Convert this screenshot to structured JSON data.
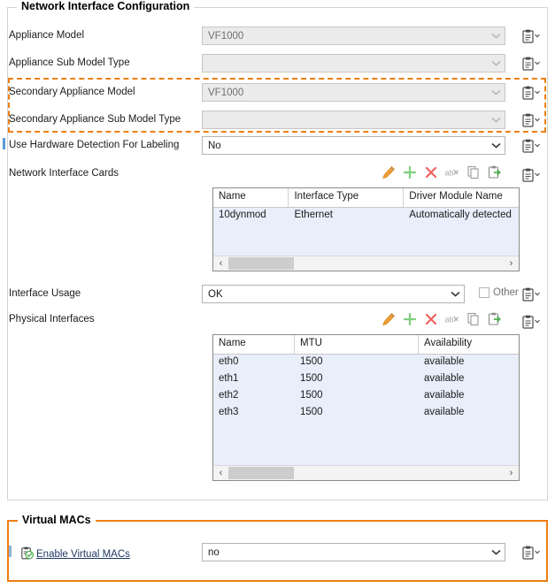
{
  "panels": {
    "network": {
      "title": "Network Interface Configuration",
      "highlight_color": "#ee7f11"
    },
    "virtual_macs": {
      "title": "Virtual MACs",
      "border_color": "#ee7f11"
    }
  },
  "fields": {
    "appliance_model": {
      "label": "Appliance Model",
      "value": "VF1000",
      "enabled": false
    },
    "appliance_sub_model_type": {
      "label": "Appliance Sub Model Type",
      "value": "",
      "enabled": false
    },
    "secondary_appliance_model": {
      "label": "Secondary Appliance Model",
      "value": "VF1000",
      "enabled": false
    },
    "secondary_appliance_sub_model_type": {
      "label": "Secondary Appliance Sub Model Type",
      "value": "",
      "enabled": false
    },
    "use_hardware_detection": {
      "label": "Use Hardware Detection For Labeling",
      "value": "No",
      "enabled": true
    },
    "interface_usage": {
      "label": "Interface Usage",
      "value": "OK",
      "enabled": true,
      "other_label": "Other",
      "other_checked": false
    },
    "enable_virtual_macs": {
      "label": "Enable Virtual MACs",
      "value": "no",
      "enabled": true
    }
  },
  "grids": {
    "network_interface_cards": {
      "label": "Network Interface Cards",
      "columns": [
        "Name",
        "Interface Type",
        "Driver Module Name"
      ],
      "rows": [
        [
          "10dynmod",
          "Ethernet",
          "Automatically detected"
        ]
      ]
    },
    "physical_interfaces": {
      "label": "Physical Interfaces",
      "columns": [
        "Name",
        "MTU",
        "Availability"
      ],
      "rows": [
        [
          "eth0",
          "1500",
          "available"
        ],
        [
          "eth1",
          "1500",
          "available"
        ],
        [
          "eth2",
          "1500",
          "available"
        ],
        [
          "eth3",
          "1500",
          "available"
        ]
      ]
    }
  },
  "toolbar": {
    "icons": [
      {
        "name": "edit-icon",
        "title": "Edit"
      },
      {
        "name": "add-icon",
        "title": "Add"
      },
      {
        "name": "delete-icon",
        "title": "Delete"
      },
      {
        "name": "rename-icon",
        "title": "Rename"
      },
      {
        "name": "copy-icon",
        "title": "Copy"
      },
      {
        "name": "paste-icon",
        "title": "Paste"
      }
    ]
  },
  "icons": {
    "clipboard": "clipboard-icon",
    "clipboard_check": "clipboard-check-icon",
    "chevron_down": "chevron-down-icon",
    "scroll_left": "‹",
    "scroll_right": "›"
  }
}
